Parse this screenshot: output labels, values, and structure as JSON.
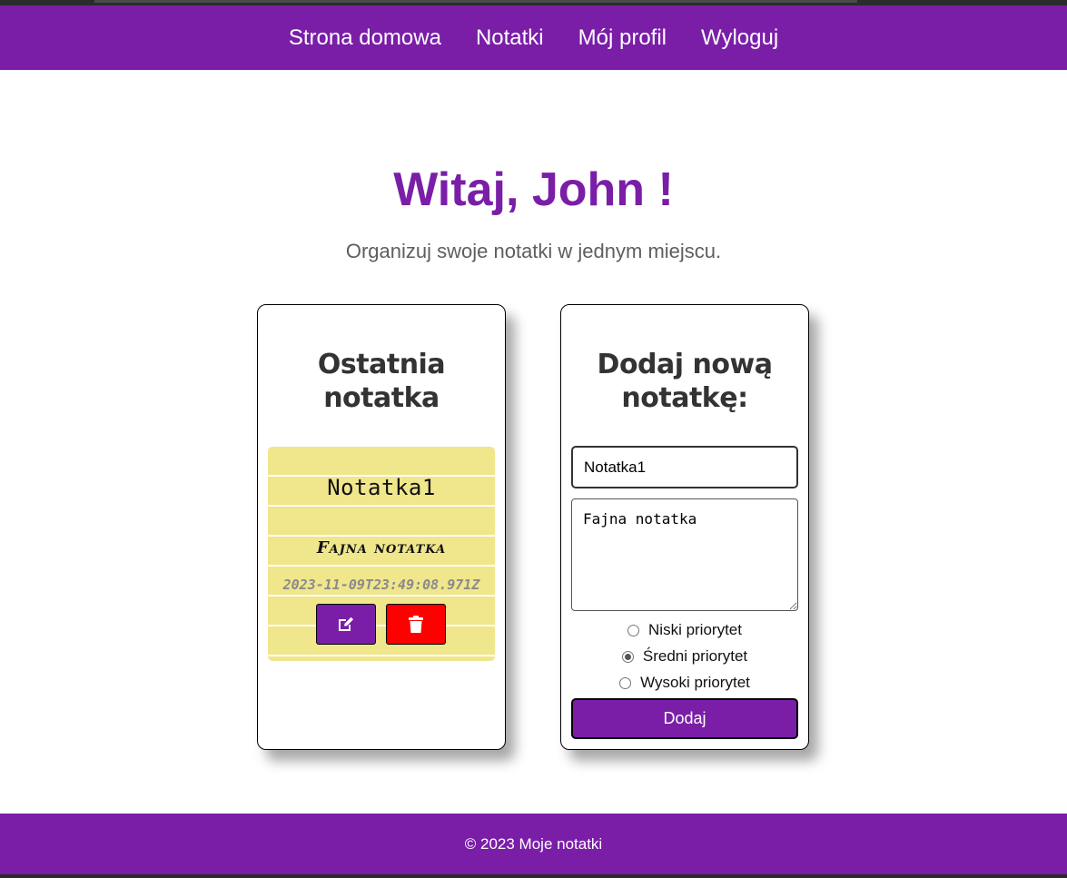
{
  "nav": {
    "items": [
      {
        "label": "Strona domowa"
      },
      {
        "label": "Notatki"
      },
      {
        "label": "Mój profil"
      },
      {
        "label": "Wyloguj"
      }
    ]
  },
  "hero": {
    "title": "Witaj, John !",
    "subtitle": "Organizuj swoje notatki w jednym miejscu."
  },
  "latest": {
    "heading_line1": "Ostatnia",
    "heading_line2": "notatka",
    "note": {
      "title": "Notatka1",
      "content": "Fajna notatka",
      "date": "2023-11-09T23:49:08.971Z"
    },
    "edit_icon": "edit-icon",
    "delete_icon": "trash-icon"
  },
  "add": {
    "heading_line1": "Dodaj nową",
    "heading_line2": "notatkę:",
    "title_value": "Notatka1",
    "content_value": "Fajna notatka",
    "priorities": [
      {
        "label": "Niski priorytet",
        "checked": false
      },
      {
        "label": "Średni priorytet",
        "checked": true
      },
      {
        "label": "Wysoki priorytet",
        "checked": false
      }
    ],
    "submit_label": "Dodaj"
  },
  "footer": {
    "text": "© 2023 Moje notatki"
  },
  "colors": {
    "accent": "#7a1ea8",
    "note_bg": "#f0e68c",
    "danger": "#ff0000"
  }
}
